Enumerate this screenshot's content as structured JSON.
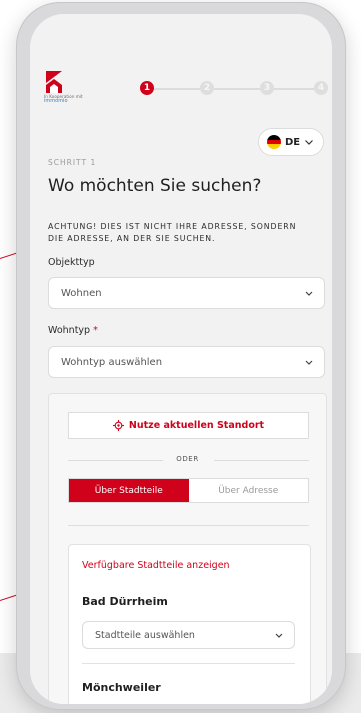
{
  "brand": {
    "cooperation": "In Kooperation mit",
    "partner": "immomio"
  },
  "stepper": {
    "steps": [
      "1",
      "2",
      "3",
      "4"
    ],
    "active_step": 1
  },
  "language": {
    "code": "DE"
  },
  "form": {
    "step_label": "SCHRITT 1",
    "title": "Wo möchten Sie suchen?",
    "warning": "ACHTUNG! DIES IST NICHT IHRE ADRESSE, SONDERN DIE ADRESSE, AN DER SIE SUCHEN.",
    "objekttyp_label": "Objekttyp",
    "objekttyp_value": "Wohnen",
    "wohntyp_label": "Wohntyp",
    "wohntyp_required": "*",
    "wohntyp_value": "Wohntyp auswählen"
  },
  "location": {
    "current_location_button": "Nutze aktuellen Standort",
    "or": "ODER",
    "toggle_districts": "Über Stadtteile",
    "toggle_address": "Über Adresse",
    "show_districts_link": "Verfügbare Stadtteile anzeigen",
    "cities": [
      {
        "name": "Bad Dürrheim",
        "select_placeholder": "Stadtteile auswählen"
      },
      {
        "name": "Mönchweiler"
      }
    ]
  },
  "colors": {
    "accent": "#d0021b",
    "background": "#f2f2f2"
  }
}
